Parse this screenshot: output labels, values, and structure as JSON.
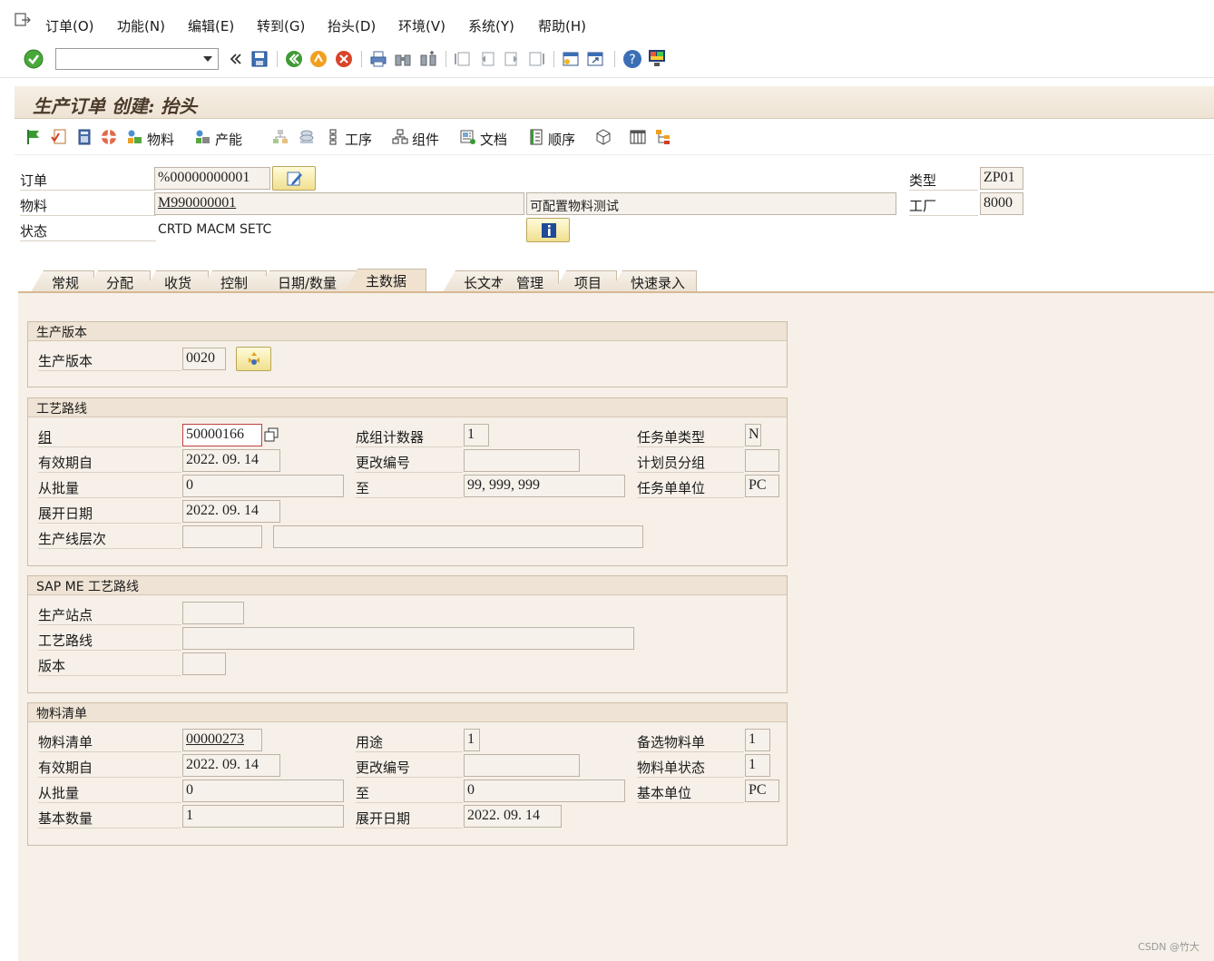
{
  "menu": {
    "items": [
      "订单(O)",
      "功能(N)",
      "编辑(E)",
      "转到(G)",
      "抬头(D)",
      "环境(V)",
      "系统(Y)",
      "帮助(H)"
    ]
  },
  "title": "生产订单 创建: 抬头",
  "app_toolbar": {
    "material": "物料",
    "capacity": "产能",
    "operations": "工序",
    "components": "组件",
    "documents": "文档",
    "sequence": "顺序"
  },
  "header": {
    "order_label": "订单",
    "order_value": "%00000000001",
    "material_label": "物料",
    "material_value": "M990000001",
    "material_desc": "可配置物料测试",
    "status_label": "状态",
    "status_value": "CRTD MACM SETC",
    "type_label": "类型",
    "type_value": "ZP01",
    "plant_label": "工厂",
    "plant_value": "8000"
  },
  "tabs": [
    "常规",
    "分配",
    "收货",
    "控制",
    "日期/数量",
    "主数据",
    "长文本",
    "管理",
    "项目",
    "快速录入"
  ],
  "active_tab": "主数据",
  "prod_version": {
    "title": "生产版本",
    "label": "生产版本",
    "value": "0020"
  },
  "routing": {
    "title": "工艺路线",
    "group_label": "组",
    "group_value": "50000166",
    "valid_from_label": "有效期自",
    "valid_from_value": "2022. 09. 14",
    "from_lot_label": "从批量",
    "from_lot_value": "0",
    "explosion_label": "展开日期",
    "explosion_value": "2022. 09. 14",
    "line_level_label": "生产线层次",
    "line_level_value": "",
    "line_level_desc": "",
    "counter_label": "成组计数器",
    "counter_value": "1",
    "change_no_label": "更改编号",
    "change_no_value": "",
    "to_label": "至",
    "to_value": "99, 999, 999",
    "task_type_label": "任务单类型",
    "task_type_value": "N",
    "planner_label": "计划员分组",
    "planner_value": "",
    "task_unit_label": "任务单单位",
    "task_unit_value": "PC"
  },
  "sapme": {
    "title": "SAP ME 工艺路线",
    "site_label": "生产站点",
    "site_value": "",
    "routing_label": "工艺路线",
    "routing_value": "",
    "version_label": "版本",
    "version_value": ""
  },
  "bom": {
    "title": "物料清单",
    "bom_label": "物料清单",
    "bom_value": "00000273",
    "valid_from_label": "有效期自",
    "valid_from_value": "2022. 09. 14",
    "from_lot_label": "从批量",
    "from_lot_value": "0",
    "base_qty_label": "基本数量",
    "base_qty_value": "1",
    "usage_label": "用途",
    "usage_value": "1",
    "change_no_label": "更改编号",
    "change_no_value": "",
    "to_label": "至",
    "to_value": "0",
    "explosion_label": "展开日期",
    "explosion_value": "2022. 09. 14",
    "alt_label": "备选物料单",
    "alt_value": "1",
    "status_label": "物料单状态",
    "status_value": "1",
    "unit_label": "基本单位",
    "unit_value": "PC"
  },
  "watermark": "CSDN @竹大",
  "icons": {
    "ok": "check-circle-icon",
    "save": "save-icon",
    "back": "back-icon",
    "exit": "exit-icon",
    "cancel": "cancel-icon",
    "print": "print-icon",
    "find": "find-icon",
    "help": "help-icon"
  }
}
